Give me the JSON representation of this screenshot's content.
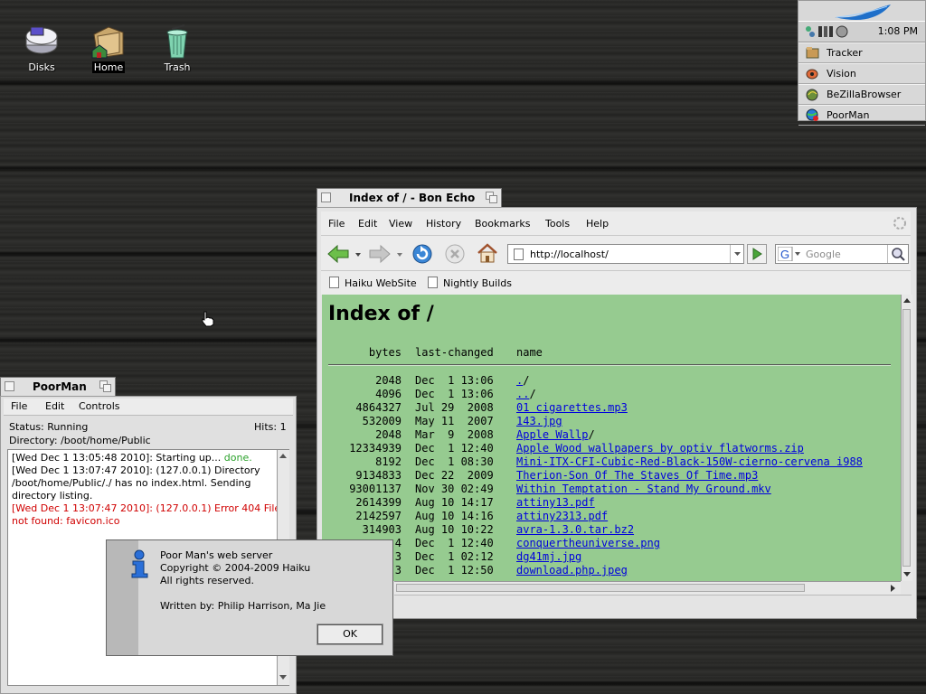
{
  "desktop": {
    "icons": [
      {
        "label": "Disks"
      },
      {
        "label": "Home"
      },
      {
        "label": "Trash"
      }
    ]
  },
  "deskbar": {
    "clock": "1:08 PM",
    "apps": [
      {
        "label": "Tracker",
        "icon": "tracker-icon"
      },
      {
        "label": "Vision",
        "icon": "vision-icon"
      },
      {
        "label": "BeZillaBrowser",
        "icon": "bezilla-icon"
      },
      {
        "label": "PoorMan",
        "icon": "poorman-icon"
      }
    ]
  },
  "browser": {
    "title": "Index of / - Bon Echo",
    "menu": [
      "File",
      "Edit",
      "View",
      "History",
      "Bookmarks",
      "Tools",
      "Help"
    ],
    "menu_access": [
      "F",
      "E",
      "V",
      "s",
      "B",
      "T",
      "H"
    ],
    "url": "http://localhost/",
    "search_placeholder": "Google",
    "bookmarks": [
      "Haiku WebSite",
      "Nightly Builds"
    ],
    "page": {
      "heading": "Index of /",
      "col_bytes": "bytes",
      "col_changed": "last-changed",
      "col_name": "name",
      "rows": [
        {
          "bytes": "2048",
          "date": "Dec  1 13:06",
          "name": ".",
          "suffix": "/"
        },
        {
          "bytes": "4096",
          "date": "Dec  1 13:06",
          "name": "..",
          "suffix": "/"
        },
        {
          "bytes": "4864327",
          "date": "Jul 29  2008",
          "name": "01 cigarettes.mp3",
          "suffix": ""
        },
        {
          "bytes": "532009",
          "date": "May 11  2007",
          "name": "143.jpg",
          "suffix": ""
        },
        {
          "bytes": "2048",
          "date": "Mar  9  2008",
          "name": "Apple Wallp",
          "suffix": "/"
        },
        {
          "bytes": "12334939",
          "date": "Dec  1 12:40",
          "name": "Apple Wood wallpapers by optiv flatworms.zip",
          "suffix": ""
        },
        {
          "bytes": "8192",
          "date": "Dec  1 08:30",
          "name": "Mini-ITX-CFI-Cubic-Red-Black-150W-cierno-cervena i988",
          "suffix": ""
        },
        {
          "bytes": "9134833",
          "date": "Dec 22  2009",
          "name": "Therion-Son Of The Staves Of Time.mp3",
          "suffix": ""
        },
        {
          "bytes": "93001137",
          "date": "Nov 30 02:49",
          "name": "Within Temptation - Stand My Ground.mkv",
          "suffix": ""
        },
        {
          "bytes": "2614399",
          "date": "Aug 10 14:17",
          "name": "attiny13.pdf",
          "suffix": ""
        },
        {
          "bytes": "2142597",
          "date": "Aug 10 14:16",
          "name": "attiny2313.pdf",
          "suffix": ""
        },
        {
          "bytes": "314903",
          "date": "Aug 10 10:22",
          "name": "avra-1.3.0.tar.bz2",
          "suffix": ""
        },
        {
          "bytes": "4",
          "date": "Dec  1 12:40",
          "name": "conquertheuniverse.png",
          "suffix": ""
        },
        {
          "bytes": "3",
          "date": "Dec  1 02:12",
          "name": "dg41mj.jpg",
          "suffix": ""
        },
        {
          "bytes": "3",
          "date": "Dec  1 12:50",
          "name": "download.php.jpeg",
          "suffix": ""
        }
      ]
    }
  },
  "poorman": {
    "title": "PoorMan",
    "menu": [
      "File",
      "Edit",
      "Controls"
    ],
    "status": "Status: Running",
    "hits": "Hits: 1",
    "directory": "Directory: /boot/home/Public",
    "log": {
      "l1": "[Wed Dec  1 13:05:48 2010]: Starting up... ",
      "l1_done": "done.",
      "l2": "[Wed Dec  1 13:07:47 2010]: (127.0.0.1) Directory /boot/home/Public/./ has no index.html.  Sending directory listing.",
      "l3": "[Wed Dec  1 13:07:47 2010]: (127.0.0.1) Error 404 File not found: favicon.ico"
    }
  },
  "about": {
    "line1": "Poor Man's web server",
    "line2": "Copyright © 2004-2009 Haiku",
    "line3": "All rights reserved.",
    "line4": "Written by: Philip Harrison, Ma Jie",
    "ok": "OK"
  }
}
